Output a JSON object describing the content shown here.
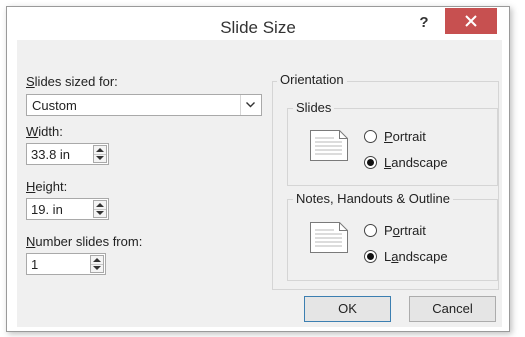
{
  "dialog": {
    "title": "Slide Size",
    "help_label": "?",
    "close_icon": "close-icon",
    "accent_close": "#c75050"
  },
  "left": {
    "sized_for_label_u": "S",
    "sized_for_label_rest": "lides sized for:",
    "sized_for_value": "Custom",
    "width_label_u": "W",
    "width_label_rest": "idth:",
    "width_value": "33.8 in",
    "height_label_u": "H",
    "height_label_rest": "eight:",
    "height_value": "19.  in",
    "number_label_u": "N",
    "number_label_rest": "umber slides from:",
    "number_value": "1"
  },
  "orientation": {
    "title": "Orientation",
    "slides": {
      "title": "Slides",
      "portrait_u": "P",
      "portrait_rest": "ortrait",
      "landscape_u": "L",
      "landscape_rest": "andscape",
      "selected": "landscape"
    },
    "notes": {
      "title": "Notes, Handouts & Outline",
      "portrait_pre": "P",
      "portrait_u": "o",
      "portrait_rest": "rtrait",
      "landscape_pre": "L",
      "landscape_u": "a",
      "landscape_rest": "ndscape",
      "selected": "landscape"
    }
  },
  "buttons": {
    "ok": "OK",
    "cancel": "Cancel"
  }
}
